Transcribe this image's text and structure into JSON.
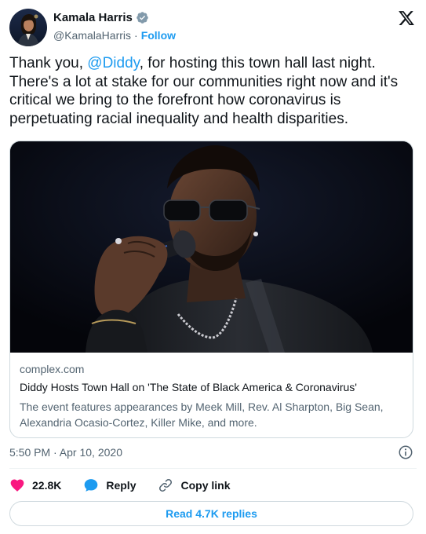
{
  "author": {
    "name": "Kamala Harris",
    "handle": "@KamalaHarris",
    "separator": "·",
    "follow_label": "Follow"
  },
  "tweet": {
    "text_before": "Thank you, ",
    "mention": "@Diddy",
    "text_after": ", for hosting this town hall last night. There's a lot at stake for our communities right now and it's critical we bring to the forefront how coronavirus is perpetuating racial inequality and health disparities."
  },
  "card": {
    "domain": "complex.com",
    "title": "Diddy Hosts Town Hall on 'The State of Black America & Coronavirus'",
    "description": "The event features appearances by Meek Mill, Rev. Al Sharpton, Big Sean, Alexandria Ocasio-Cortez, Killer Mike, and more."
  },
  "timestamp": "5:50 PM · Apr 10, 2020",
  "actions": {
    "likes": "22.8K",
    "reply_label": "Reply",
    "copy_link_label": "Copy link"
  },
  "read_replies_label": "Read 4.7K replies",
  "colors": {
    "accent": "#1d9bf0",
    "like": "#f91880",
    "secondary_text": "#536471"
  },
  "icons": [
    "verified-badge-icon",
    "x-logo-icon",
    "info-icon",
    "heart-icon",
    "reply-bubble-icon",
    "link-icon"
  ]
}
